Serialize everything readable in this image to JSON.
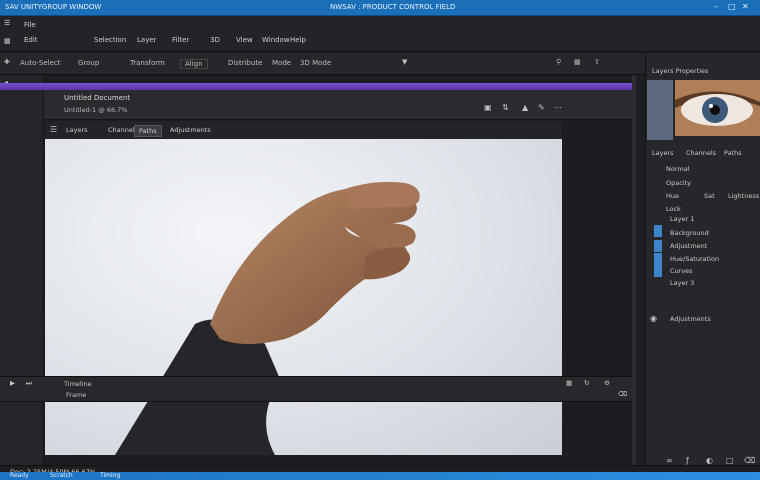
{
  "titlebar": {
    "left_text": "SAV UNITYGROUP WINDOW",
    "center_text": "NWSAV : PRODUCT CONTROL FIELD",
    "controls": [
      "minimize-icon",
      "maximize-icon",
      "close-icon"
    ]
  },
  "menubar": {
    "row1": [
      "File"
    ],
    "row2": [
      "Edit",
      "Selection",
      "Layer",
      "Filter",
      "3D",
      "View",
      "Window",
      "Help"
    ]
  },
  "toolbar": {
    "items": [
      "Auto-Select",
      "Group",
      "Transform",
      "Align",
      "Distribute",
      "Mode",
      "3D Mode"
    ]
  },
  "document": {
    "title": "Untitled Document",
    "subtitle": "Untitled-1 @ 66.7%",
    "tabs": [
      "Layers",
      "Channels",
      "Paths",
      "Adjustments"
    ],
    "active_tab": 2
  },
  "timeline": {
    "label": "Timeline",
    "sub_label": "Frame"
  },
  "right_panel": {
    "header": "Layers Properties",
    "tabs": [
      "Layers",
      "Channels",
      "Paths"
    ],
    "rows": [
      "Normal",
      "Opacity",
      "Lock",
      "Layer 1",
      "Background",
      "Adjustment",
      "Hue/Saturation",
      "Curves"
    ],
    "footer_label": "Layer 3",
    "bottom_item": "Adjustments",
    "adjust_row": [
      "Hue",
      "Sat",
      "Lightness"
    ]
  },
  "statusbar": {
    "text": "Doc: 2.25M/4.50M  66.67%",
    "blue_items": [
      "Ready",
      "Scratch",
      "Timing"
    ]
  },
  "colors": {
    "accent": "#1b6fb8",
    "purple": "#6a41bd",
    "layer_swatch": "#3f84c9"
  }
}
